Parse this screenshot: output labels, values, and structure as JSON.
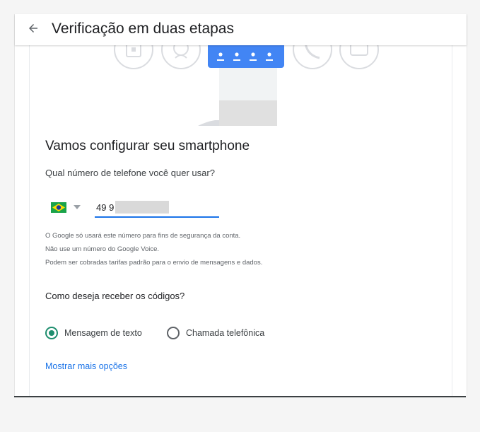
{
  "header": {
    "back_icon": "arrow-left-icon",
    "title": "Verificação em duas etapas"
  },
  "illustration": {
    "left_icons": [
      "security-key-icon",
      "authenticator-icon"
    ],
    "right_icons": [
      "phone-call-icon",
      "backup-codes-icon"
    ],
    "accent_color": "#4285f4"
  },
  "setup": {
    "title": "Vamos configurar seu smartphone",
    "phone_question": "Qual número de telefone você quer usar?",
    "country_flag": "brazil-flag-icon",
    "phone_value": "49 9",
    "info_lines": [
      "O Google só usará este número para fins de segurança da conta.",
      "Não use um número do Google Voice.",
      "Podem ser cobradas tarifas padrão para o envio de mensagens e dados."
    ],
    "receive_question": "Como deseja receber os códigos?",
    "options": [
      {
        "label": "Mensagem de texto",
        "selected": true
      },
      {
        "label": "Chamada telefônica",
        "selected": false
      }
    ],
    "more_options_link": "Mostrar mais opções"
  },
  "colors": {
    "link": "#1a73e8",
    "input_underline": "#1a73e8",
    "radio_selected": "#1e8e6e"
  }
}
